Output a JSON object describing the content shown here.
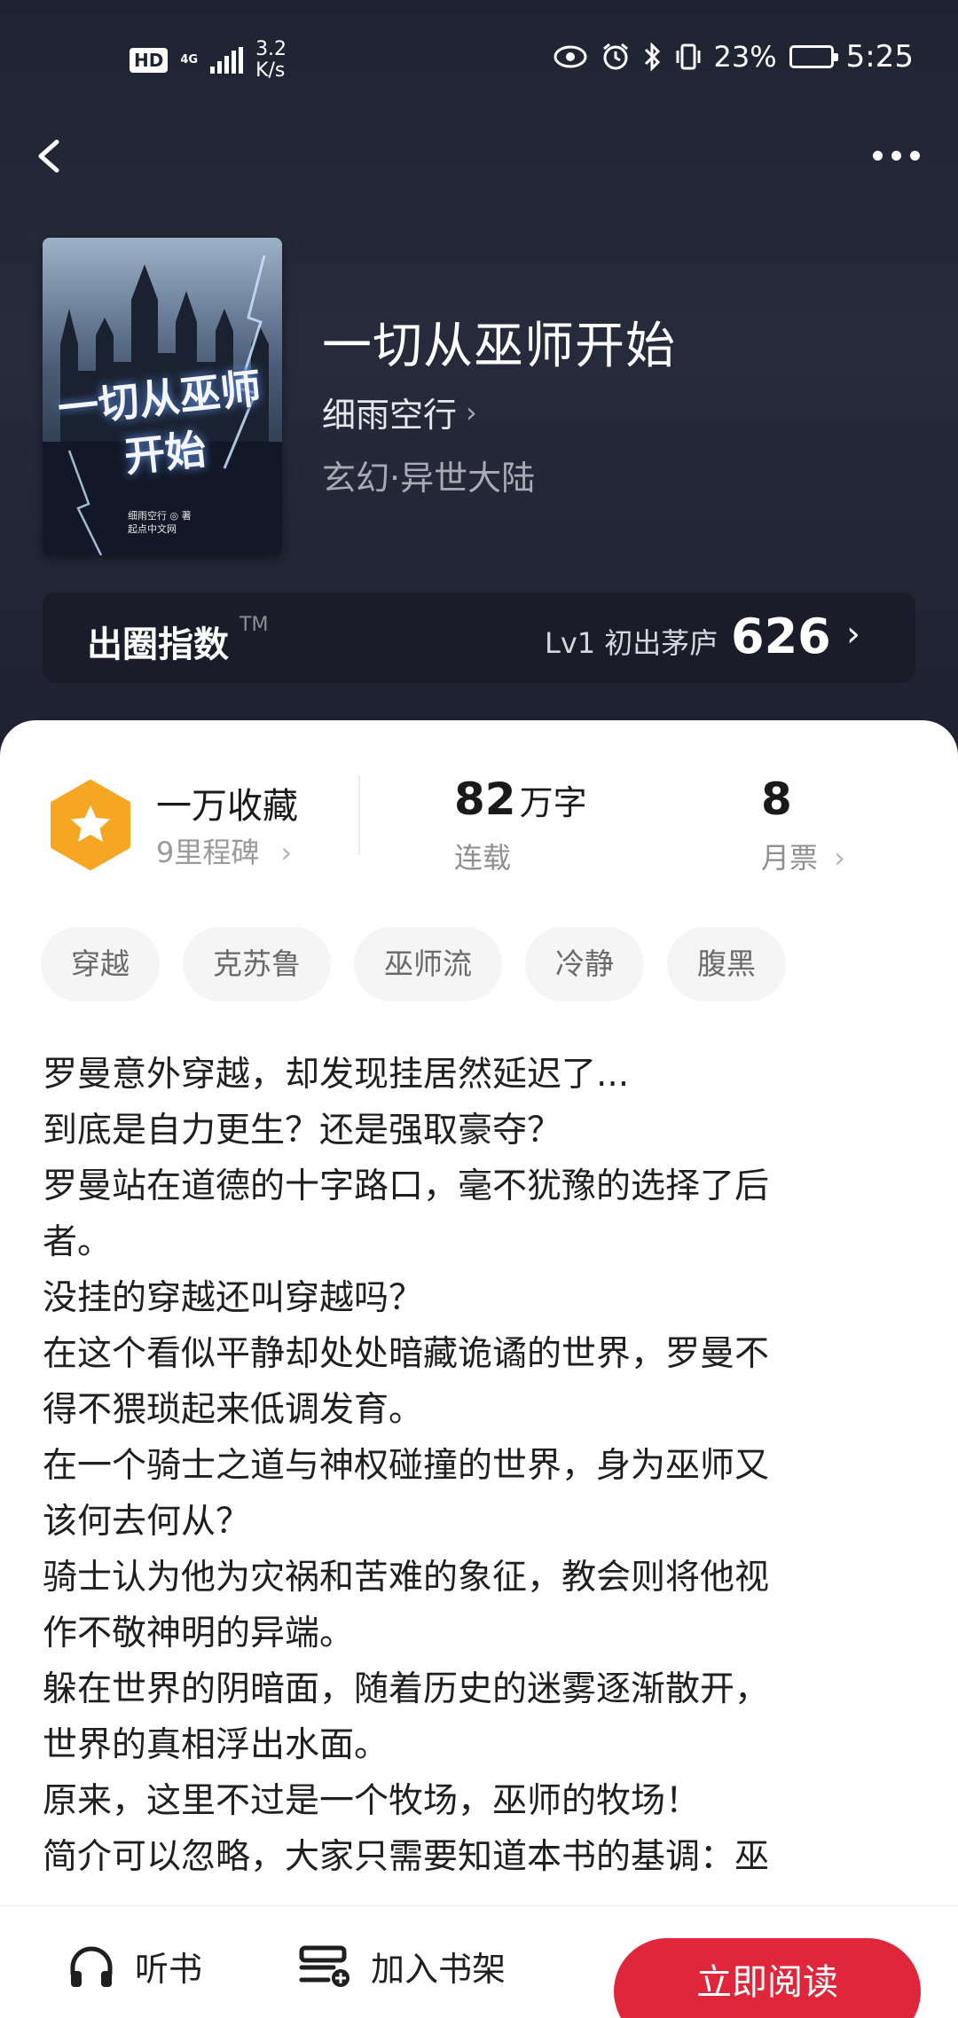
{
  "status_bar": {
    "hd": "HD",
    "network": "4G",
    "speed_value": "3.2",
    "speed_unit": "K/s",
    "battery_pct": "23%",
    "battery_level": 0.23,
    "time": "5:25",
    "icons": [
      "eye-icon",
      "alarm-icon",
      "bluetooth-icon",
      "vibrate-icon"
    ]
  },
  "book": {
    "title": "一切从巫师开始",
    "author": "细雨空行",
    "genre": "玄幻·异世大陆",
    "cover": {
      "title_line1": "一切从巫师",
      "title_line2": "开始",
      "author_credit": "细雨空行 ◎ 著",
      "publisher": "起点中文网"
    }
  },
  "popularity": {
    "label": "出圈指数",
    "tm": "TM",
    "level": "Lv1 初出茅庐",
    "score": "626"
  },
  "stats": {
    "collection_title": "一万收藏",
    "collection_sub": "9里程碑",
    "word_count_value": "82",
    "word_count_unit": "万字",
    "serial_status": "连载",
    "monthly_votes": "8",
    "monthly_votes_label": "月票"
  },
  "tags": [
    "穿越",
    "克苏鲁",
    "巫师流",
    "冷静",
    "腹黑"
  ],
  "synopsis": [
    "罗曼意外穿越，却发现挂居然延迟了...",
    "到底是自力更生？还是强取豪夺？",
    "罗曼站在道德的十字路口，毫不犹豫的选择了后",
    "者。",
    "没挂的穿越还叫穿越吗？",
    "在这个看似平静却处处暗藏诡谲的世界，罗曼不",
    "得不猥琐起来低调发育。",
    "在一个骑士之道与神权碰撞的世界，身为巫师又",
    "该何去何从？",
    "骑士认为他为灾祸和苦难的象征，教会则将他视",
    "作不敬神明的异端。",
    "躲在世界的阴暗面，随着历史的迷雾逐渐散开，",
    "世界的真相浮出水面。",
    "原来，这里不过是一个牧场，巫师的牧场！",
    "简介可以忽略，大家只需要知道本书的基调：巫"
  ],
  "bottom_bar": {
    "listen": "听书",
    "add_shelf": "加入书架",
    "read_now": "立即阅读"
  },
  "colors": {
    "header_bg": "#1f2433",
    "accent_red": "#e0263a",
    "badge_orange": "#f5a623"
  }
}
